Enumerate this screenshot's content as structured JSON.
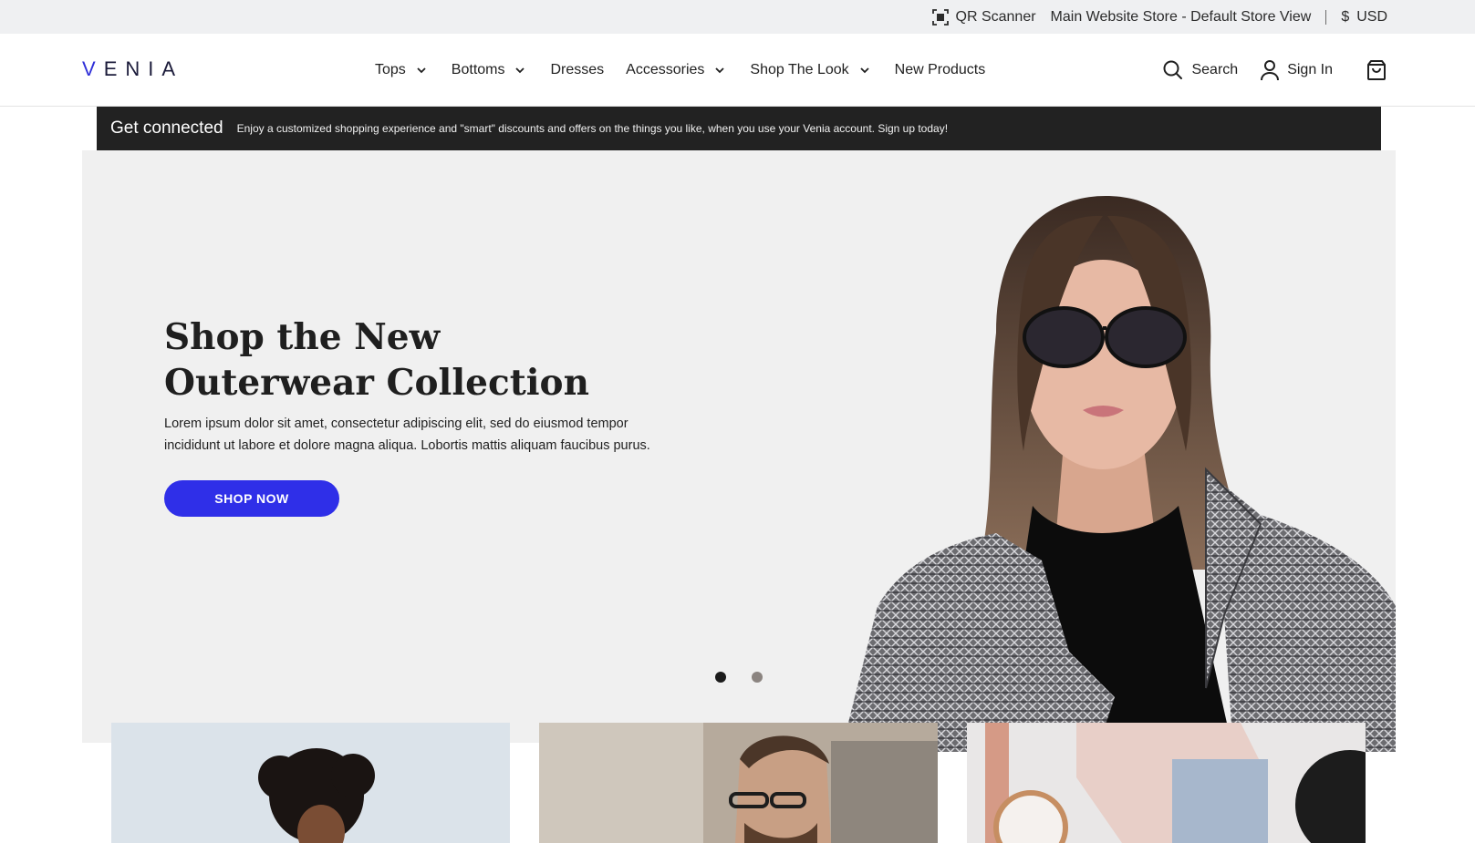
{
  "topbar": {
    "qr_label": "QR Scanner",
    "store_view": "Main Website Store - Default Store View",
    "currency_symbol": "$",
    "currency": "USD"
  },
  "header": {
    "logo": "VENIA",
    "nav": [
      {
        "label": "Tops",
        "has_dropdown": true
      },
      {
        "label": "Bottoms",
        "has_dropdown": true
      },
      {
        "label": "Dresses",
        "has_dropdown": false
      },
      {
        "label": "Accessories",
        "has_dropdown": true
      },
      {
        "label": "Shop The Look",
        "has_dropdown": true
      },
      {
        "label": "New Products",
        "has_dropdown": false
      }
    ],
    "search_label": "Search",
    "signin_label": "Sign In",
    "icons": [
      "search-icon",
      "user-icon",
      "shopping-bag-icon"
    ]
  },
  "banner": {
    "title": "Get connected",
    "text": "Enjoy a customized shopping experience and \"smart\" discounts and offers on the things you like, when you use your Venia account. Sign up today!"
  },
  "hero": {
    "title_line1": "Shop the New",
    "title_line2": "Outerwear Collection",
    "text": "Lorem ipsum dolor sit amet, consectetur adipiscing elit, sed do eiusmod tempor incididunt ut labore et dolore magna aliqua. Lobortis mattis aliquam faucibus purus.",
    "button_label": "SHOP NOW",
    "slide_count": 2,
    "active_slide": 1
  },
  "colors": {
    "accent": "#2f2fe8",
    "banner_bg": "#222222",
    "hero_bg": "#f0f0f0",
    "topbar_bg": "#eff0f2"
  }
}
